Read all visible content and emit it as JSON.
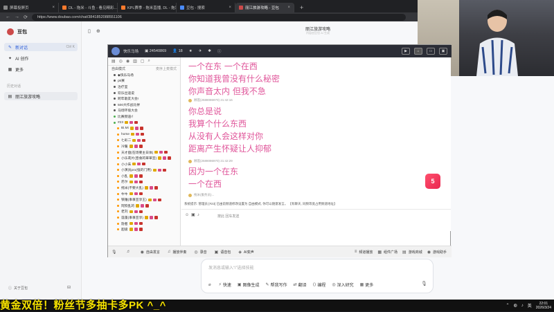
{
  "tabs": [
    {
      "title": "屏幕投屏页",
      "active": false
    },
    {
      "title": "DL - 拖米 - 斗鱼 - 看见精彩...",
      "active": false
    },
    {
      "title": "KPL赛季 - 拖米直播, DL - 拖米直...",
      "active": false
    },
    {
      "title": "豆包 - 搜索",
      "active": false
    },
    {
      "title": "丽江旅游攻略 - 豆包",
      "active": true
    }
  ],
  "address": {
    "url": "https://www.doubao.com/chat/3841852088551106"
  },
  "sidebar": {
    "brand": "豆包",
    "items": [
      {
        "label": "新对话",
        "shortcut": "Ctrl K",
        "active": true
      },
      {
        "label": "AI 创作",
        "shortcut": "",
        "active": false
      },
      {
        "label": "更多",
        "shortcut": "",
        "active": false
      }
    ],
    "history_label": "历史对话",
    "history": [
      {
        "label": "丽江旅游攻略"
      }
    ],
    "about": "关于豆包"
  },
  "main": {
    "title": "丽江旅游攻略",
    "subtitle": "内容由豆包 AI 生成"
  },
  "stream": {
    "channel": "快乐马场",
    "id": "24540869",
    "viewers": "18",
    "roster_mode": "自由模式",
    "roster_right": "麦序上麦模式",
    "roster": [
      {
        "name": "◆快乐马场",
        "color": "#555"
      },
      {
        "name": "pk赛",
        "color": "#555"
      },
      {
        "name": "治疗室",
        "color": "#555"
      },
      {
        "name": "欢乐出道说",
        "color": "#555"
      },
      {
        "name": "跨年歌友大会!",
        "color": "#555"
      },
      {
        "name": "500大作战比拼",
        "color": "#555"
      },
      {
        "name": "马场环境大会",
        "color": "#555"
      },
      {
        "name": "比赛频道!！",
        "color": "#4caf50"
      },
      {
        "name": "#23",
        "color": "#4caf50"
      },
      {
        "name": "Bi.Mi",
        "color": "#ff9800"
      },
      {
        "name": "horse",
        "color": "#ff9800"
      },
      {
        "name": "七彩二",
        "color": "#ff9800"
      },
      {
        "name": "冷暖",
        "color": "#ff9800"
      },
      {
        "name": "天才盘(在场要主日体)",
        "color": "#ff9800"
      },
      {
        "name": "小乐莉片(音會的單單宣)",
        "color": "#ff9800"
      },
      {
        "name": "小小朱",
        "color": "#ff9800"
      },
      {
        "name": "小演员pro(强的门用)",
        "color": "#ff9800"
      },
      {
        "name": "小乱",
        "color": "#ff9800"
      },
      {
        "name": "尼尔",
        "color": "#ff9800"
      },
      {
        "name": "拖米(不要大乱)",
        "color": "#ff9800"
      },
      {
        "name": "牛牛",
        "color": "#ff9800"
      },
      {
        "name": "铁锤(事事宣享王)",
        "color": "#ff9800"
      },
      {
        "name": "阿狗乱的",
        "color": "#ff9800"
      },
      {
        "name": "老刘",
        "color": "#ff9800"
      },
      {
        "name": "莲蓬(事事宣享)",
        "color": "#ff9800"
      },
      {
        "name": "隐者",
        "color": "#ff9800"
      },
      {
        "name": "超级",
        "color": "#ff9800"
      }
    ],
    "chat_lines": [
      "一个在东  一个在西",
      "你知道我曾没有什么秘密",
      "你声音太内  但我不急",
      "你总是说",
      "我算个什么东西",
      "从没有人会这样对你",
      "距离产生怀疑让人抑郁",
      "因为一个在东",
      "一个在西"
    ],
    "meta": [
      "顾莲(2588086970)  21:42:16",
      "顾莲(2588086970)  21:42:29",
      "拖米(服务员)..."
    ],
    "notice": "系统提示: 管理员 [#23] 已由前频道修改设置为 自由模式, 你可以随意发言。 【有聊天, 同频等宽占用频道地址】",
    "input_placeholder": "按此 回车发送",
    "bottom_buttons": [
      "自由发言",
      "播放伴奏",
      "录音",
      "语音包",
      "AI变声"
    ],
    "bottom_right": [
      "频道播放",
      "组件广场",
      "游戏商城",
      "游戏助手"
    ],
    "gift_label": "5"
  },
  "askbox": {
    "placeholder": "发消息或输入“/”选择技能",
    "tools": [
      "快速",
      "图像生成",
      "帮我写作",
      "翻译",
      "编程",
      "深入研究",
      "更多"
    ]
  },
  "marquee": "黄金双倍！粉丝节多抽卡多PK ^_^",
  "clock": {
    "time": "22:01",
    "date": "2026/3/24"
  },
  "lang": "英"
}
